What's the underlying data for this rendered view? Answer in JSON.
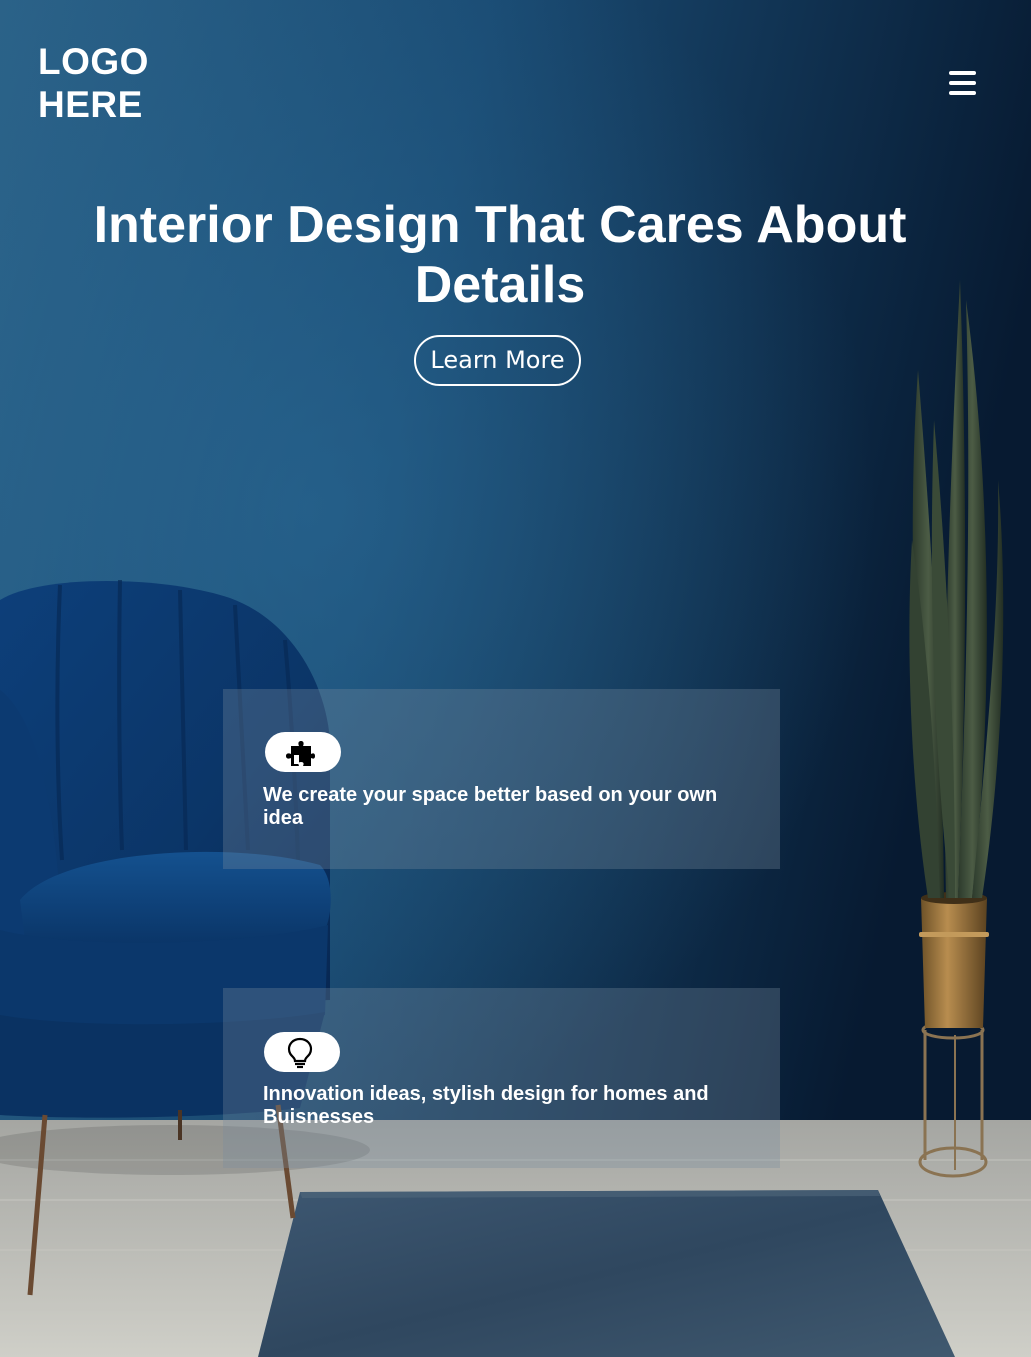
{
  "header": {
    "logo_line1": "LOGO",
    "logo_line2": "HERE",
    "menu_icon": "hamburger-menu-icon"
  },
  "hero": {
    "headline": "Interior Design That Cares About Details",
    "cta_label": "Learn More"
  },
  "features": [
    {
      "icon": "puzzle-piece-icon",
      "text": "We create your space better based on your own idea"
    },
    {
      "icon": "lightbulb-icon",
      "text": "Innovation ideas, stylish design for homes and Buisnesses"
    }
  ],
  "colors": {
    "wall": "#1b4d75",
    "wall_dark": "#0a1f38",
    "text": "#ffffff",
    "card_overlay": "rgba(120,140,160,0.32)"
  }
}
